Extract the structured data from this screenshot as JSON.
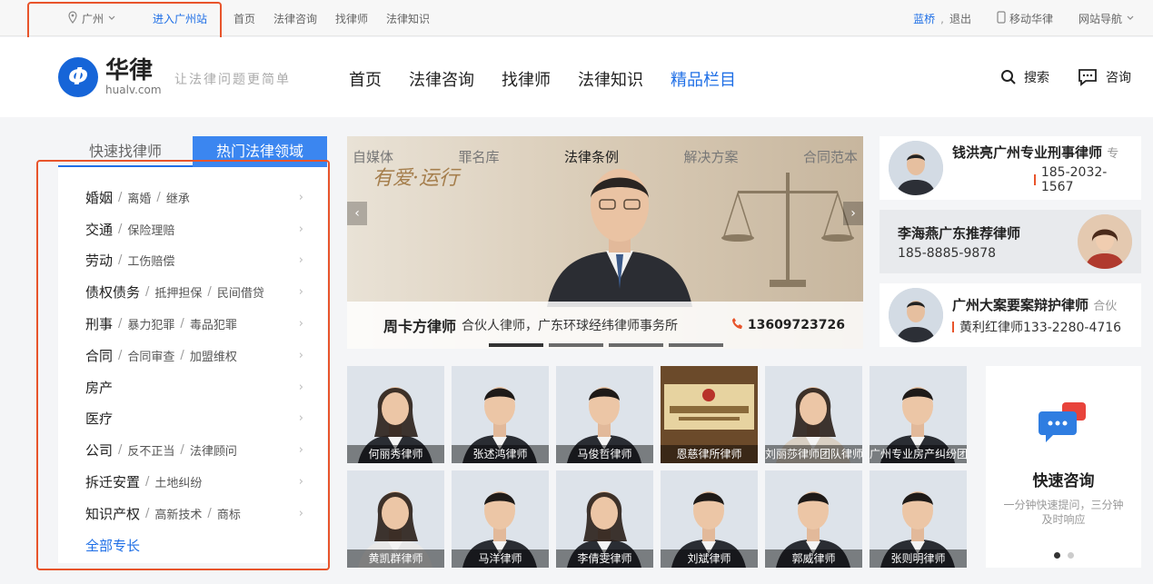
{
  "topbar": {
    "city": "广州",
    "enter_city": "进入广州站",
    "links": [
      "首页",
      "法律咨询",
      "找律师",
      "法律知识"
    ],
    "user": "蓝桥",
    "logout": "退出",
    "mobile": "移动华律",
    "site_nav": "网站导航"
  },
  "header": {
    "logo_cn": "华律",
    "logo_en": "hualv.com",
    "slogan": "让法律问题更简单",
    "nav": [
      "首页",
      "法律咨询",
      "找律师",
      "法律知识"
    ],
    "nav_active": "精品栏目",
    "search": "搜索",
    "consult": "咨询"
  },
  "left": {
    "tab1": "快速找律师",
    "tab2": "热门法律领域",
    "categories": [
      {
        "main": "婚姻",
        "subs": [
          "离婚",
          "继承"
        ]
      },
      {
        "main": "交通",
        "subs": [
          "保险理赔"
        ]
      },
      {
        "main": "劳动",
        "subs": [
          "工伤赔偿"
        ]
      },
      {
        "main": "债权债务",
        "subs": [
          "抵押担保",
          "民间借贷"
        ]
      },
      {
        "main": "刑事",
        "subs": [
          "暴力犯罪",
          "毒品犯罪"
        ]
      },
      {
        "main": "合同",
        "subs": [
          "合同审查",
          "加盟维权"
        ]
      },
      {
        "main": "房产",
        "subs": []
      },
      {
        "main": "医疗",
        "subs": []
      },
      {
        "main": "公司",
        "subs": [
          "反不正当",
          "法律顾问"
        ]
      },
      {
        "main": "拆迁安置",
        "subs": [
          "土地纠纷"
        ]
      },
      {
        "main": "知识产权",
        "subs": [
          "高新技术",
          "商标"
        ]
      }
    ],
    "all": "全部专长"
  },
  "banner": {
    "tabs": [
      "自媒体",
      "罪名库",
      "法律条例",
      "解决方案",
      "合同范本"
    ],
    "slogan": "有爱·运行",
    "name": "周卡方律师",
    "desc": "合伙人律师，广东环球经纬律师事务所",
    "phone": "13609723726"
  },
  "right_cards": [
    {
      "title": "钱洪亮广州专业刑事律师",
      "sub": "专",
      "phone": "185-2032-1567"
    },
    {
      "title": "李海燕广东推荐律师",
      "sub": "",
      "phone": "185-8885-9878"
    },
    {
      "title": "广州大案要案辩护律师",
      "sub": "合伙",
      "phone": "黄利红律师133-2280-4716"
    }
  ],
  "lawyers": [
    "何丽秀律师",
    "张述鸿律师",
    "马俊哲律师",
    "恩慈律所律师",
    "刘丽莎律师团队律师",
    "广州专业房产纠纷团",
    "黄凯群律师",
    "马洋律师",
    "李倩雯律师",
    "刘斌律师",
    "郭威律师",
    "张则明律师"
  ],
  "quick": {
    "title": "快速咨询",
    "desc": "一分钟快速提问，三分钟及时响应"
  },
  "colors": {
    "accent": "#1f6fe6",
    "highlight": "#e8542b"
  }
}
